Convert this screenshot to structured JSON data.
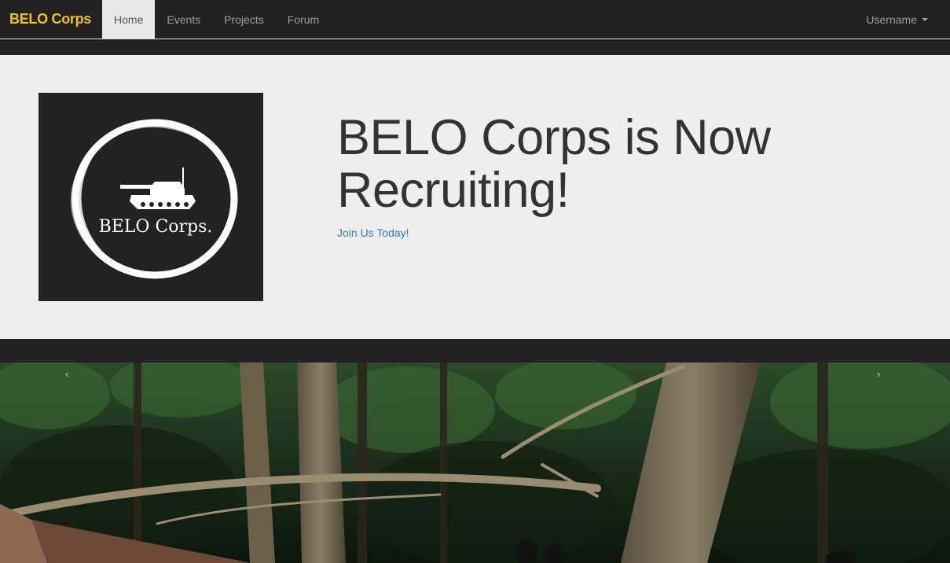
{
  "navbar": {
    "brand": "BELO Corps",
    "items": [
      {
        "label": "Home",
        "active": true
      },
      {
        "label": "Events",
        "active": false
      },
      {
        "label": "Projects",
        "active": false
      },
      {
        "label": "Forum",
        "active": false
      }
    ],
    "user_menu": "Username"
  },
  "jumbotron": {
    "logo_text": "BELO Corps.",
    "headline": "BELO Corps is Now Recruiting!",
    "link": "Join Us Today!"
  },
  "carousel": {
    "prev_icon": "chevron-left-icon",
    "next_icon": "chevron-right-icon",
    "prev_glyph": "‹",
    "next_glyph": "›"
  },
  "colors": {
    "brand": "#f2c317",
    "navbar_bg": "#222222",
    "jumbotron_bg": "#eeeeee",
    "link": "#337ab7"
  }
}
